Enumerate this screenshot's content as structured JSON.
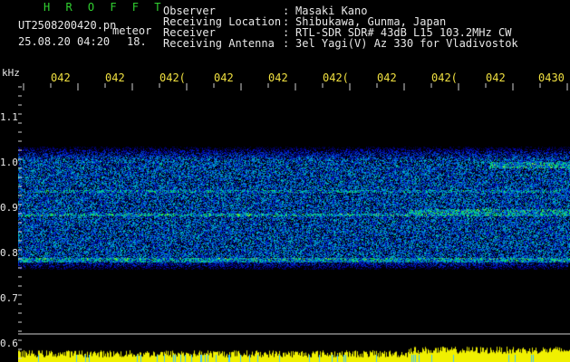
{
  "header": {
    "brand": "H R O F F T",
    "filename": "UT2508200420.pn",
    "filename_ext": "meteor",
    "date": "25.08.20 04:20",
    "count": "18."
  },
  "meta": [
    {
      "label": "Observer",
      "value": "Masaki Kano"
    },
    {
      "label": "Receiving Location",
      "value": "Shibukawa, Gunma, Japan"
    },
    {
      "label": "Receiver",
      "value": "RTL-SDR SDR# 43dB L15 103.2MHz CW"
    },
    {
      "label": "Receiving Antenna",
      "value": "3el Yagi(V) Az 330 for Vladivostok"
    }
  ],
  "axis": {
    "unit": "kHz",
    "y_ticks": [
      "1.1",
      "1.0",
      "0.9",
      "0.8",
      "0.7",
      "0.6"
    ],
    "x_ticks": [
      "042",
      "042",
      "042(",
      "042",
      "042",
      "042(",
      "042",
      "042(",
      "042",
      "0430"
    ]
  },
  "colors": {
    "background": "#000000",
    "text": "#e8e8e8",
    "brand": "#30d030",
    "time_labels": "#f0e040",
    "signal_strip": "#f0f000"
  }
}
